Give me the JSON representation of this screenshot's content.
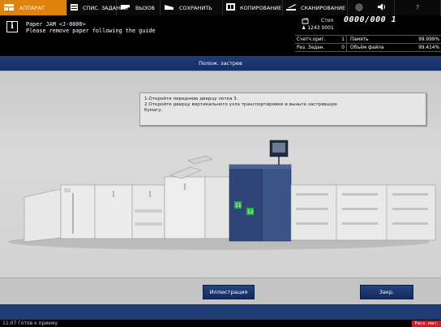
{
  "tabs": [
    {
      "label": "АППАРАТ",
      "icon": "machine-icon",
      "active": true
    },
    {
      "label": "СПИС. ЗАДАНИЙ",
      "icon": "list-icon",
      "active": false
    },
    {
      "label": "ВЫЗОВ",
      "icon": "recall-icon",
      "active": false
    },
    {
      "label": "СОХРАНИТЬ",
      "icon": "save-icon",
      "active": false
    },
    {
      "label": "КОПИРОВАНИЕ",
      "icon": "copy-icon",
      "active": false
    },
    {
      "label": "СКАНИРОВАНИЕ",
      "icon": "scan-icon",
      "active": false
    }
  ],
  "header": {
    "message_line1": "Paper JAM  <J-0000>",
    "message_line2": "Please remove paper following the guide",
    "stop_label": "Стоп",
    "count": "0000/000 1",
    "user_id": "1243  0001",
    "counters": [
      {
        "label": "Счетч.ориг.",
        "value": "1",
        "label2": "Память",
        "value2": "99.999%"
      },
      {
        "label": "Рез. Задан.",
        "value": "0",
        "label2": "Объём файла",
        "value2": "99.414%"
      }
    ]
  },
  "title": "Полож. застрев",
  "instructions": {
    "line1": "1.Откройте переднюю дверцу лотка 3.",
    "line2": "2.Откройте дверцу вертикального узла транспортировки и выньте застрявшую",
    "line3": "бумагу."
  },
  "machine_labels": {
    "door1": "11",
    "door2": "12"
  },
  "buttons": {
    "illustration": "Иллюстрация",
    "close": "Закр."
  },
  "status": {
    "text": "11:07  Готов к приему",
    "alert": "Расх. мат."
  },
  "colors": {
    "accent": "#e0820e",
    "title_blue": "#1e3b74",
    "door_green": "#2bb04a",
    "alert_red": "#c6202a"
  }
}
